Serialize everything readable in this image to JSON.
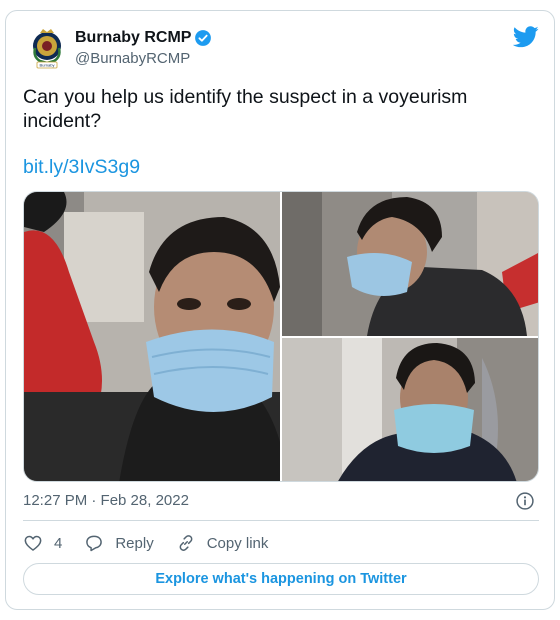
{
  "author": {
    "name": "Burnaby RCMP",
    "handle": "@BurnabyRCMP",
    "avatar_icon": "rcmp-crest-icon",
    "crest_text": "Burnaby",
    "verified_color": "#1d9bf0"
  },
  "tweet": {
    "text": "Can you help us identify the suspect in a voyeurism incident?",
    "link": "bit.ly/3IvS3g9",
    "timestamp": "12:27 PM · Feb 28, 2022"
  },
  "media": {
    "photos": [
      "suspect-photo-closeup",
      "suspect-photo-side-profile",
      "suspect-photo-front"
    ]
  },
  "actions": {
    "like_count": "4",
    "reply_label": "Reply",
    "copy_link_label": "Copy link"
  },
  "explore_label": "Explore what's happening on Twitter",
  "colors": {
    "link": "#1b95e0",
    "border": "#cfd9de",
    "muted_text": "#536471",
    "twitter_blue": "#1d9bf0"
  }
}
